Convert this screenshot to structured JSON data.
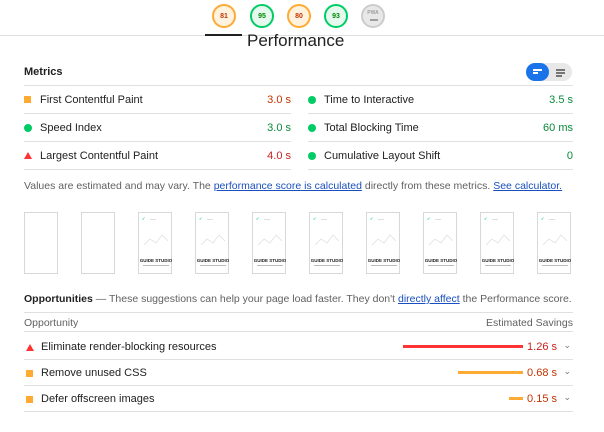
{
  "scores": [
    {
      "value": "81",
      "status": "average"
    },
    {
      "value": "95",
      "status": "pass"
    },
    {
      "value": "80",
      "status": "average"
    },
    {
      "value": "93",
      "status": "pass"
    },
    {
      "value": "PWA",
      "status": "na"
    }
  ],
  "performance_title": "Performance",
  "metrics": {
    "heading": "Metrics",
    "items": [
      {
        "label": "First Contentful Paint",
        "value": "3.0 s",
        "status": "average"
      },
      {
        "label": "Time to Interactive",
        "value": "3.5 s",
        "status": "pass"
      },
      {
        "label": "Speed Index",
        "value": "3.0 s",
        "status": "pass"
      },
      {
        "label": "Total Blocking Time",
        "value": "60 ms",
        "status": "pass"
      },
      {
        "label": "Largest Contentful Paint",
        "value": "4.0 s",
        "status": "fail"
      },
      {
        "label": "Cumulative Layout Shift",
        "value": "0",
        "status": "pass"
      }
    ]
  },
  "estimate": {
    "prefix": "Values are estimated and may vary. The ",
    "link1": "performance score is calculated",
    "middle": " directly from these metrics. ",
    "link2": "See calculator."
  },
  "filmstrip": {
    "frame_caption": "GUIDE STUDIO",
    "frame_logo": "✓"
  },
  "opportunities": {
    "heading": "Opportunities",
    "description_prefix": " — These suggestions can help your page load faster. They don't ",
    "description_link": "directly affect",
    "description_suffix": " the Performance score.",
    "col_opportunity": "Opportunity",
    "col_savings": "Estimated Savings",
    "items": [
      {
        "label": "Eliminate render-blocking resources",
        "savings": "1.26 s",
        "status": "fail",
        "fraction": 1.0
      },
      {
        "label": "Remove unused CSS",
        "savings": "0.68 s",
        "status": "average",
        "fraction": 0.54
      },
      {
        "label": "Defer offscreen images",
        "savings": "0.15 s",
        "status": "average",
        "fraction": 0.12
      }
    ]
  },
  "colors": {
    "pass": "#00cc66",
    "average": "#ffaa33",
    "fail": "#ff3333",
    "link": "#1a4fbf",
    "toggle": "#1a73e8"
  }
}
